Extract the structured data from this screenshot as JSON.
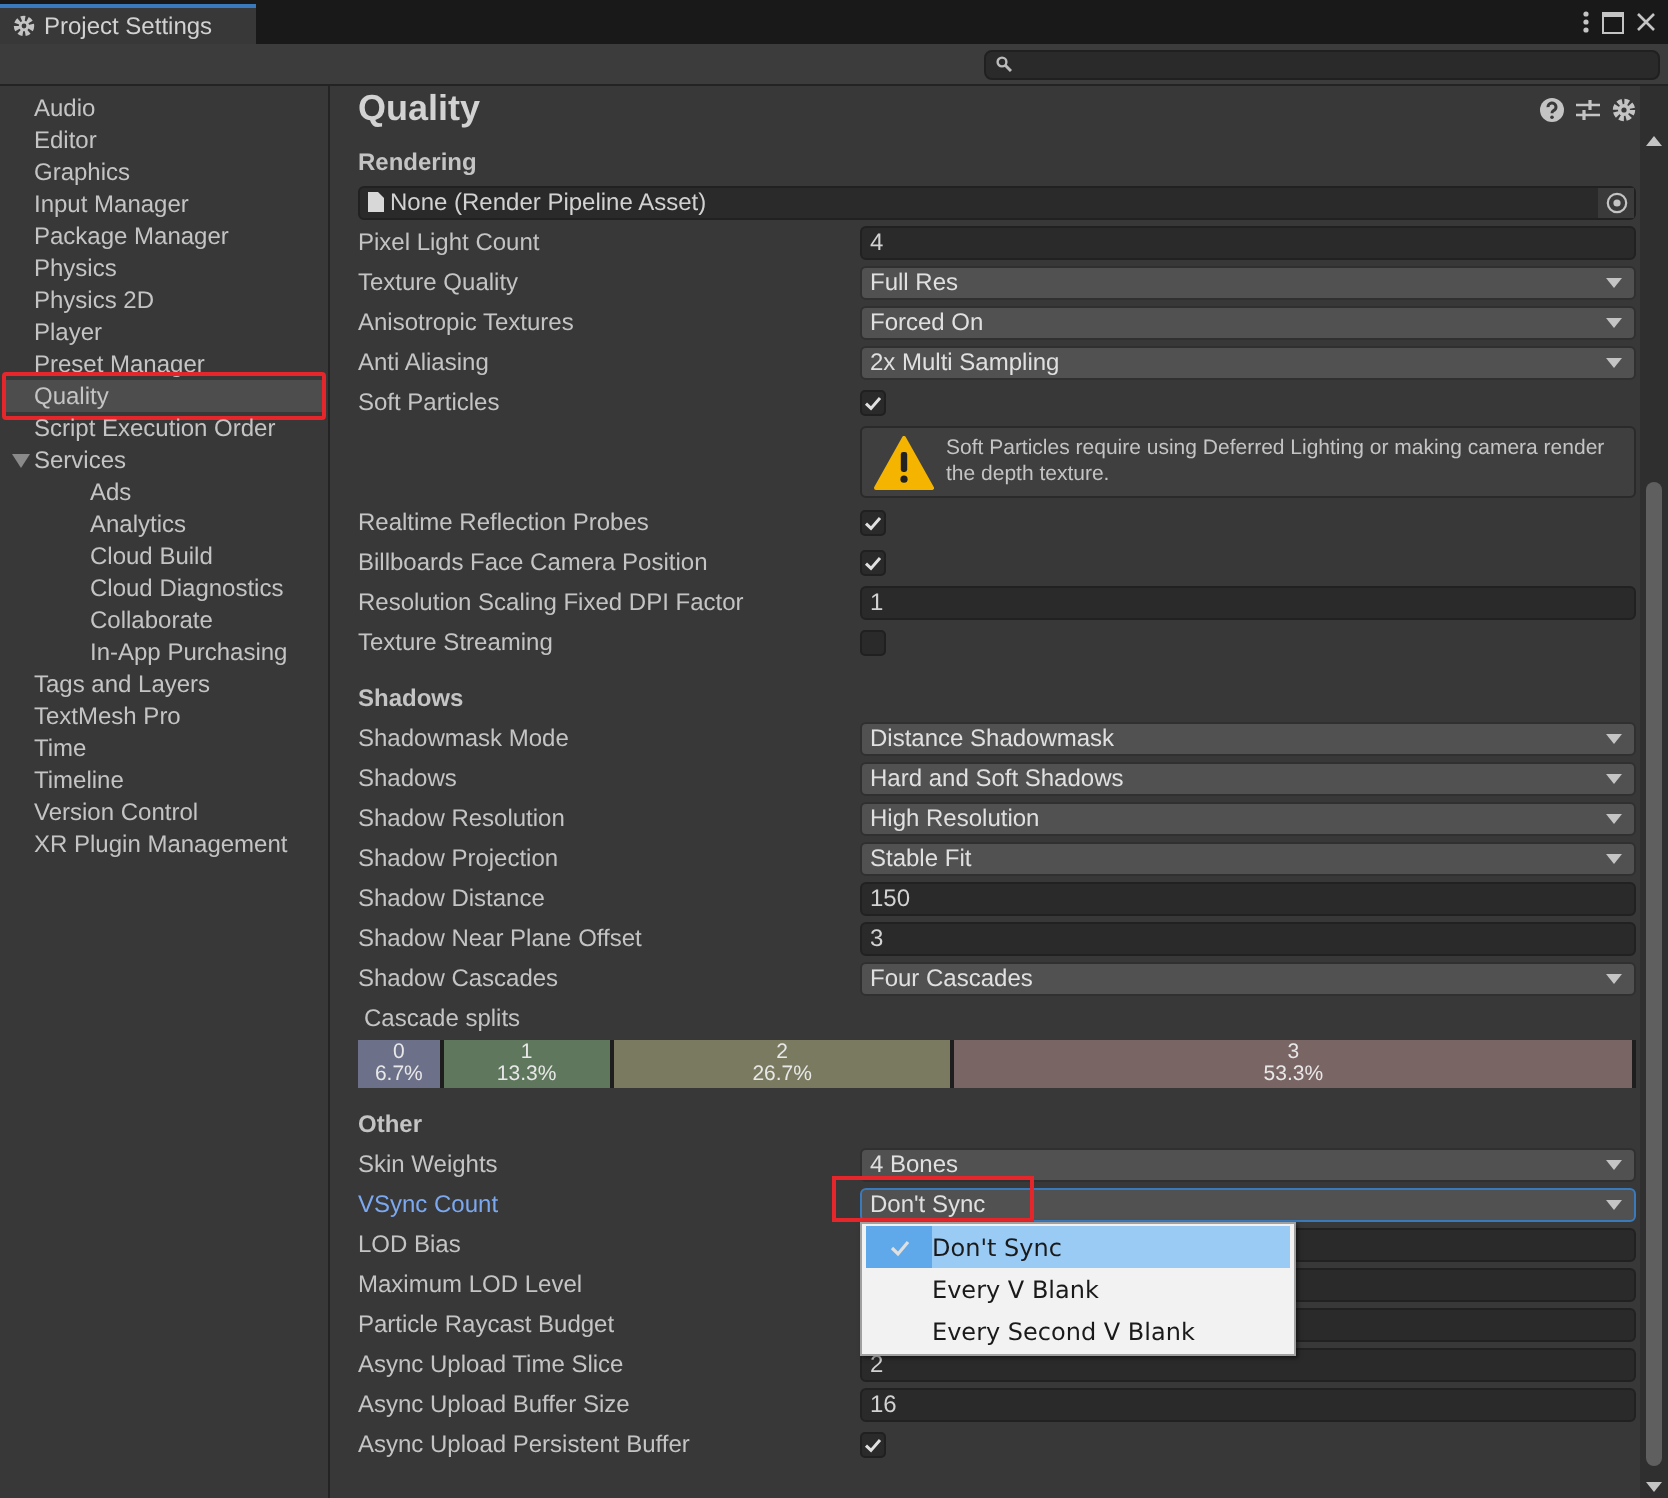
{
  "window": {
    "tab": "Project Settings"
  },
  "sidebar": {
    "items": [
      {
        "label": "Audio",
        "selected": false
      },
      {
        "label": "Editor",
        "selected": false
      },
      {
        "label": "Graphics",
        "selected": false
      },
      {
        "label": "Input Manager",
        "selected": false
      },
      {
        "label": "Package Manager",
        "selected": false
      },
      {
        "label": "Physics",
        "selected": false
      },
      {
        "label": "Physics 2D",
        "selected": false
      },
      {
        "label": "Player",
        "selected": false
      },
      {
        "label": "Preset Manager",
        "selected": false
      },
      {
        "label": "Quality",
        "selected": true,
        "annotated": true
      },
      {
        "label": "Script Execution Order",
        "selected": false
      },
      {
        "label": "Services",
        "selected": false,
        "expanded": true,
        "children": [
          {
            "label": "Ads",
            "selected": false
          },
          {
            "label": "Analytics",
            "selected": false
          },
          {
            "label": "Cloud Build",
            "selected": false
          },
          {
            "label": "Cloud Diagnostics",
            "selected": false
          },
          {
            "label": "Collaborate",
            "selected": false
          },
          {
            "label": "In-App Purchasing",
            "selected": false
          }
        ]
      },
      {
        "label": "Tags and Layers",
        "selected": false
      },
      {
        "label": "TextMesh Pro",
        "selected": false
      },
      {
        "label": "Time",
        "selected": false
      },
      {
        "label": "Timeline",
        "selected": false
      },
      {
        "label": "Version Control",
        "selected": false
      },
      {
        "label": "XR Plugin Management",
        "selected": false
      }
    ]
  },
  "inspector": {
    "title": "Quality",
    "sections": [
      {
        "title": "Rendering",
        "rows": [
          {
            "kind": "object",
            "value": "None (Render Pipeline Asset)"
          },
          {
            "kind": "number",
            "label": "Pixel Light Count",
            "value": "4"
          },
          {
            "kind": "dropdown",
            "label": "Texture Quality",
            "value": "Full Res"
          },
          {
            "kind": "dropdown",
            "label": "Anisotropic Textures",
            "value": "Forced On"
          },
          {
            "kind": "dropdown",
            "label": "Anti Aliasing",
            "value": "2x Multi Sampling"
          },
          {
            "kind": "checkbox",
            "label": "Soft Particles",
            "checked": true
          },
          {
            "kind": "help",
            "text": "Soft Particles require using Deferred Lighting or making camera render the depth texture."
          },
          {
            "kind": "checkbox",
            "label": "Realtime Reflection Probes",
            "checked": true
          },
          {
            "kind": "checkbox",
            "label": "Billboards Face Camera Position",
            "checked": true
          },
          {
            "kind": "number",
            "label": "Resolution Scaling Fixed DPI Factor",
            "value": "1"
          },
          {
            "kind": "checkbox",
            "label": "Texture Streaming",
            "checked": false
          }
        ]
      },
      {
        "title": "Shadows",
        "rows": [
          {
            "kind": "dropdown",
            "label": "Shadowmask Mode",
            "value": "Distance Shadowmask"
          },
          {
            "kind": "dropdown",
            "label": "Shadows",
            "value": "Hard and Soft Shadows"
          },
          {
            "kind": "dropdown",
            "label": "Shadow Resolution",
            "value": "High Resolution"
          },
          {
            "kind": "dropdown",
            "label": "Shadow Projection",
            "value": "Stable Fit"
          },
          {
            "kind": "number",
            "label": "Shadow Distance",
            "value": "150"
          },
          {
            "kind": "number",
            "label": "Shadow Near Plane Offset",
            "value": "3"
          },
          {
            "kind": "dropdown",
            "label": "Shadow Cascades",
            "value": "Four Cascades"
          },
          {
            "kind": "cascade",
            "label": "Cascade splits",
            "splits": [
              {
                "index": "0",
                "percent": "6.7%",
                "level": 0.067,
                "color": "#6c7089"
              },
              {
                "index": "1",
                "percent": "13.3%",
                "level": 0.133,
                "color": "#5f775c"
              },
              {
                "index": "2",
                "percent": "26.7%",
                "level": 0.267,
                "color": "#7a7a60"
              },
              {
                "index": "3",
                "percent": "53.3%",
                "level": 0.533,
                "color": "#7a6565"
              }
            ]
          }
        ]
      },
      {
        "title": "Other",
        "rows": [
          {
            "kind": "dropdown",
            "label": "Skin Weights",
            "value": "4 Bones"
          },
          {
            "kind": "dropdown",
            "label": "VSync Count",
            "value": "Don't Sync",
            "focused": true,
            "annotated": true
          },
          {
            "kind": "number",
            "label": "LOD Bias"
          },
          {
            "kind": "number",
            "label": "Maximum LOD Level"
          },
          {
            "kind": "number",
            "label": "Particle Raycast Budget"
          },
          {
            "kind": "number",
            "label": "Async Upload Time Slice",
            "value": "2"
          },
          {
            "kind": "number",
            "label": "Async Upload Buffer Size",
            "value": "16"
          },
          {
            "kind": "checkbox",
            "label": "Async Upload Persistent Buffer",
            "checked": true
          }
        ]
      }
    ]
  },
  "popup": {
    "options": [
      {
        "label": "Don't Sync",
        "selected": true
      },
      {
        "label": "Every V Blank",
        "selected": false
      },
      {
        "label": "Every Second V Blank",
        "selected": false
      }
    ]
  }
}
